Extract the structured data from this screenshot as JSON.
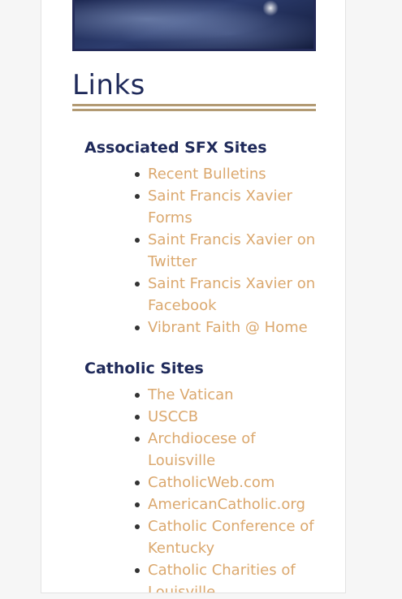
{
  "links_section": {
    "title": "Links"
  },
  "groups": [
    {
      "heading": "Associated SFX Sites",
      "links": [
        "Recent Bulletins",
        "Saint Francis Xavier Forms",
        "Saint Francis Xavier on Twitter",
        "Saint Francis Xavier on Facebook",
        "Vibrant Faith @ Home"
      ]
    },
    {
      "heading": "Catholic Sites",
      "links": [
        "The Vatican",
        "USCCB",
        "Archdiocese of Louisville",
        "CatholicWeb.com",
        "AmericanCatholic.org",
        "Catholic Conference of Kentucky",
        "Catholic Charities of Louisville"
      ]
    }
  ],
  "colors": {
    "heading": "#1f2a5a",
    "link": "#dba86e",
    "rule": "#b29a73"
  }
}
